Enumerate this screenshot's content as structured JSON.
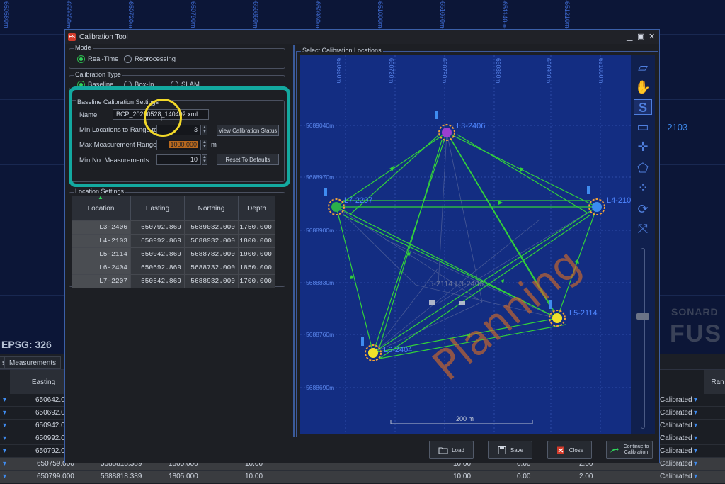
{
  "background": {
    "top_ticks": [
      "650580m",
      "650650m",
      "650720m",
      "650790m",
      "650860m",
      "650930m",
      "651000m",
      "651070m",
      "651140m",
      "651210m"
    ],
    "epsg": "EPSG: 326",
    "side_station": "-2103",
    "brand_top": "SONARD",
    "brand_bottom": "FUS",
    "tabs": [
      "s",
      "Measurements"
    ],
    "table_headers": [
      "Easting",
      "Ran"
    ],
    "rows": [
      {
        "easting": "650642.0",
        "status": "Calibrated"
      },
      {
        "easting": "650692.0",
        "status": "Calibrated"
      },
      {
        "easting": "650942.0",
        "status": "Calibrated"
      },
      {
        "easting": "650992.0",
        "status": "Calibrated"
      },
      {
        "easting": "650792.0",
        "status": "Calibrated"
      },
      {
        "easting": "650759.000",
        "northing": "5688818.389",
        "depth": "1805.000",
        "c1": "10.00",
        "c2": "10.00",
        "c3": "0.00",
        "c4": "2.00",
        "status": "Calibrated"
      },
      {
        "easting": "650799.000",
        "northing": "5688818.389",
        "depth": "1805.000",
        "c1": "10.00",
        "c2": "10.00",
        "c3": "0.00",
        "c4": "2.00",
        "status": "Calibrated"
      }
    ]
  },
  "dialog": {
    "title": "Calibration Tool",
    "app_icon": "FS",
    "mode": {
      "label": "Mode",
      "options": [
        "Real-Time",
        "Reprocessing"
      ],
      "selected": "Real-Time"
    },
    "calibration_type": {
      "label": "Calibration Type",
      "options": [
        "Baseline",
        "Box-In",
        "SLAM"
      ]
    },
    "baseline": {
      "label": "Baseline Calibration Settings",
      "name_label": "Name",
      "name_value": "BCP_20200528_140402.xml",
      "min_locations_label": "Min Locations to Range to",
      "min_locations_value": "3",
      "max_range_label": "Max Measurement Range",
      "max_range_value": "1000.000",
      "max_range_unit": "m",
      "min_meas_label": "Min No. Measurements",
      "min_meas_value": "10",
      "view_status_btn": "View Calibration Status",
      "reset_btn": "Reset To Defaults"
    },
    "location_settings": {
      "label": "Location Settings",
      "headers": [
        "Location",
        "Easting",
        "Northing",
        "Depth"
      ],
      "rows": [
        [
          "L3-2406",
          "650792.869",
          "5689032.000",
          "1750.000"
        ],
        [
          "L4-2103",
          "650992.869",
          "5688932.000",
          "1800.000"
        ],
        [
          "L5-2114",
          "650942.869",
          "5688782.000",
          "1900.000"
        ],
        [
          "L6-2404",
          "650692.869",
          "5688732.000",
          "1850.000"
        ],
        [
          "L7-2207",
          "650642.869",
          "5688932.000",
          "1700.000"
        ]
      ]
    },
    "map": {
      "label": "Select Calibration Locations",
      "x_ticks": [
        "650650m",
        "650720m",
        "650790m",
        "650860m",
        "650930m",
        "651000m"
      ],
      "y_ticks": [
        "5689040m",
        "5688970m",
        "5688900m",
        "5688830m",
        "5688760m",
        "5688690m"
      ],
      "watermark": "Planning",
      "scale": "200 m",
      "stations": [
        {
          "id": "L3-2406",
          "label": "L3-2406"
        },
        {
          "id": "L4-2103",
          "label": "L4-210"
        },
        {
          "id": "L5-2114",
          "label": "L5-2114"
        },
        {
          "id": "L6-2404",
          "label": "L6-2404"
        },
        {
          "id": "L7-2207",
          "label": "L7-2207"
        }
      ],
      "ghost_label": "L5-2114 L3-2406"
    },
    "buttons": {
      "load": "Load",
      "save": "Save",
      "close": "Close",
      "continue": "Continue to Calibration"
    }
  }
}
